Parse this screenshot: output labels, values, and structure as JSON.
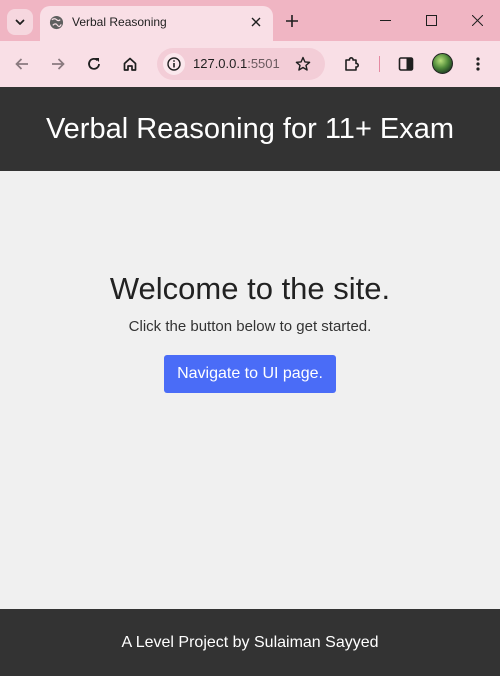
{
  "browser": {
    "tab_title": "Verbal Reasoning",
    "url_host": "127.0.0.1",
    "url_port": ":5501",
    "icons": {
      "tab_search": "chevron-down-icon",
      "favicon": "globe-icon",
      "tab_close": "close-icon",
      "new_tab": "plus-icon",
      "minimize": "minimize-icon",
      "maximize": "maximize-icon",
      "close_window": "close-icon",
      "back": "arrow-left-icon",
      "forward": "arrow-right-icon",
      "reload": "reload-icon",
      "home": "home-icon",
      "site_info": "info-icon",
      "bookmark": "star-icon",
      "extensions": "puzzle-icon",
      "side_panel": "side-panel-icon",
      "menu": "more-vertical-icon"
    },
    "colors": {
      "tabstrip": "#f0b5c3",
      "toolbar": "#f9dfe6"
    }
  },
  "page": {
    "header_title": "Verbal Reasoning for 11+ Exam",
    "welcome_heading": "Welcome to the site.",
    "welcome_subtext": "Click the button below to get started.",
    "cta_label": "Navigate to UI page.",
    "footer_text": "A Level Project by Sulaiman Sayyed",
    "colors": {
      "header_bg": "#333333",
      "body_bg": "#f0f0f0",
      "button_bg": "#4a6cf7"
    }
  }
}
